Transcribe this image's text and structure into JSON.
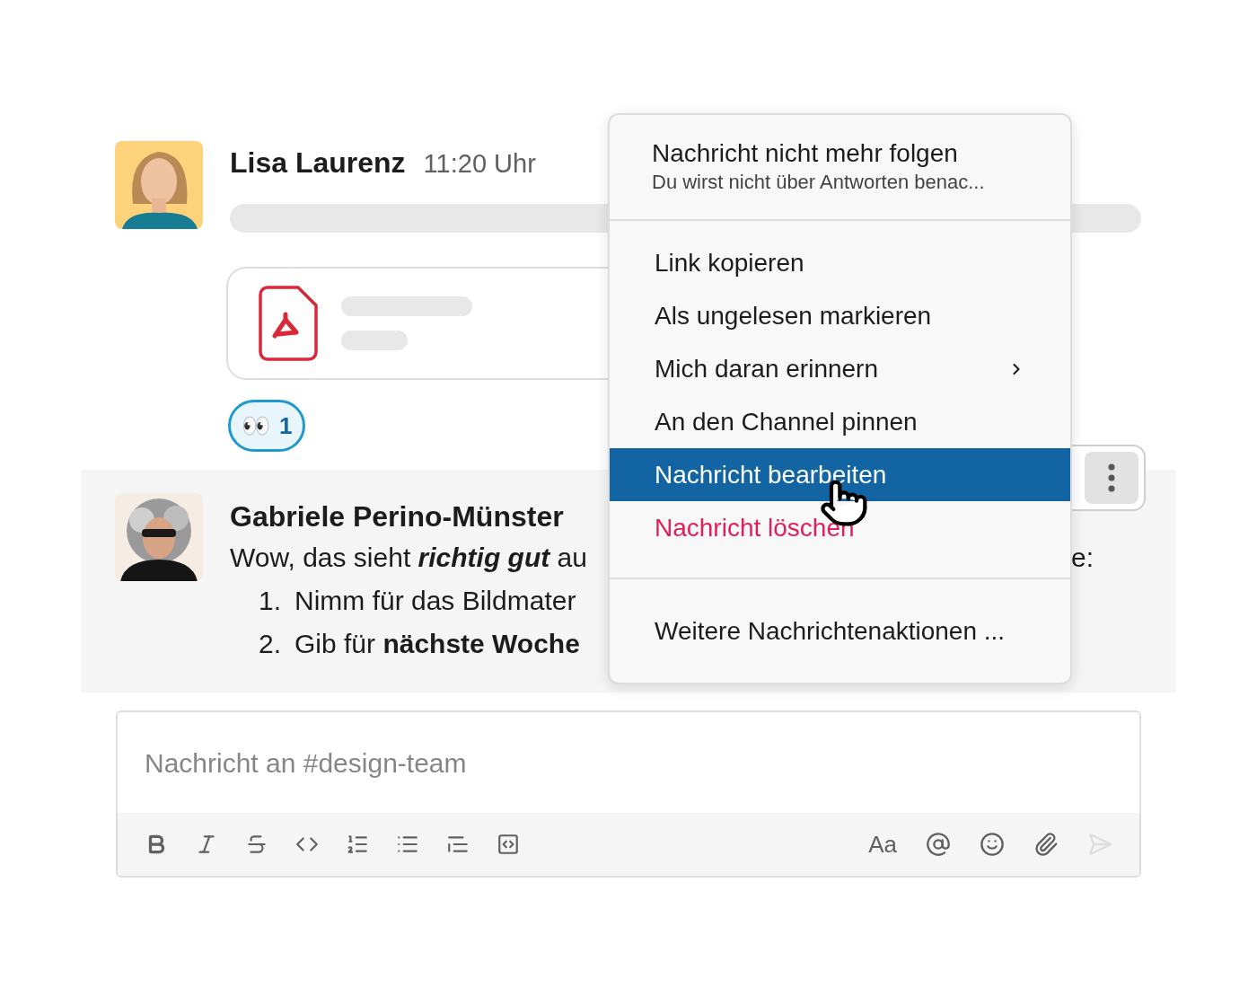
{
  "messages": [
    {
      "author": "Lisa Laurenz",
      "time": "11:20 Uhr",
      "attachment": {
        "kind": "pdf"
      },
      "reactions": [
        {
          "emoji": "👀",
          "count": "1",
          "selected": true
        }
      ]
    },
    {
      "author": "Gabriele Perino-Münster",
      "lines": [
        {
          "kind": "text",
          "text": "Wow, das sieht *richtig gut* au",
          "tail": "e:"
        },
        {
          "kind": "list",
          "number": "1.",
          "text": "Nimm für das Bildmater"
        },
        {
          "kind": "list",
          "number": "2.",
          "text": "Gib für **nächste Woche**"
        }
      ],
      "hovered": true
    }
  ],
  "context_menu": {
    "sections": [
      {
        "items": [
          {
            "kind": "header",
            "label": "Nachricht nicht mehr folgen",
            "description": "Du wirst nicht über Antworten benac...",
            "selected": false
          }
        ]
      },
      {
        "items": [
          {
            "kind": "action",
            "label": "Link kopieren",
            "selected": false
          },
          {
            "kind": "action",
            "label": "Als ungelesen markieren",
            "selected": false
          },
          {
            "kind": "submenu",
            "label": "Mich daran erinnern",
            "selected": false
          },
          {
            "kind": "action",
            "label": "An den Channel pinnen",
            "selected": false
          },
          {
            "kind": "action",
            "label": "Nachricht bearbeiten",
            "selected": true
          },
          {
            "kind": "danger",
            "label": "Nachricht löschen",
            "selected": false
          }
        ]
      },
      {
        "items": [
          {
            "kind": "action",
            "label": "Weitere Nachrichtenaktionen ...",
            "selected": false
          }
        ]
      }
    ]
  },
  "composer": {
    "placeholder": "Nachricht an #design-team",
    "format_label": "Aa",
    "send_enabled": false
  }
}
